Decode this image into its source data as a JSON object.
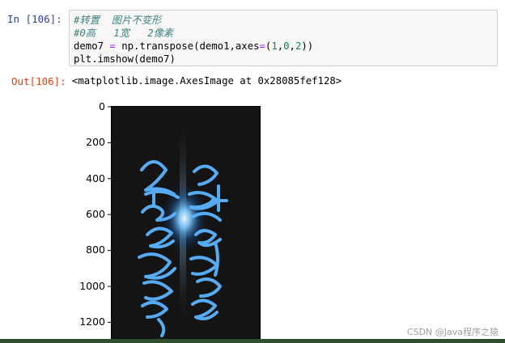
{
  "in_prompt": "In  [106]:",
  "out_prompt": "Out[106]:",
  "code": {
    "line1": "#转置  图片不变形",
    "line2": "#0高   1宽   2像素",
    "line3": {
      "a": "demo7 ",
      "eq": "=",
      "b": " np.transpose(demo1,axes",
      "eq2": "=",
      "c": "(",
      "n1": "1",
      "d": ",",
      "n2": "0",
      "e": ",",
      "n3": "2",
      "f": "))"
    },
    "line4": "plt.imshow(demo7)"
  },
  "output_text": "<matplotlib.image.AxesImage at 0x28085fef128>",
  "yticks": [
    "0",
    "200",
    "400",
    "600",
    "800",
    "1000",
    "1200"
  ],
  "watermark": "CSDN @Java程序之猿"
}
